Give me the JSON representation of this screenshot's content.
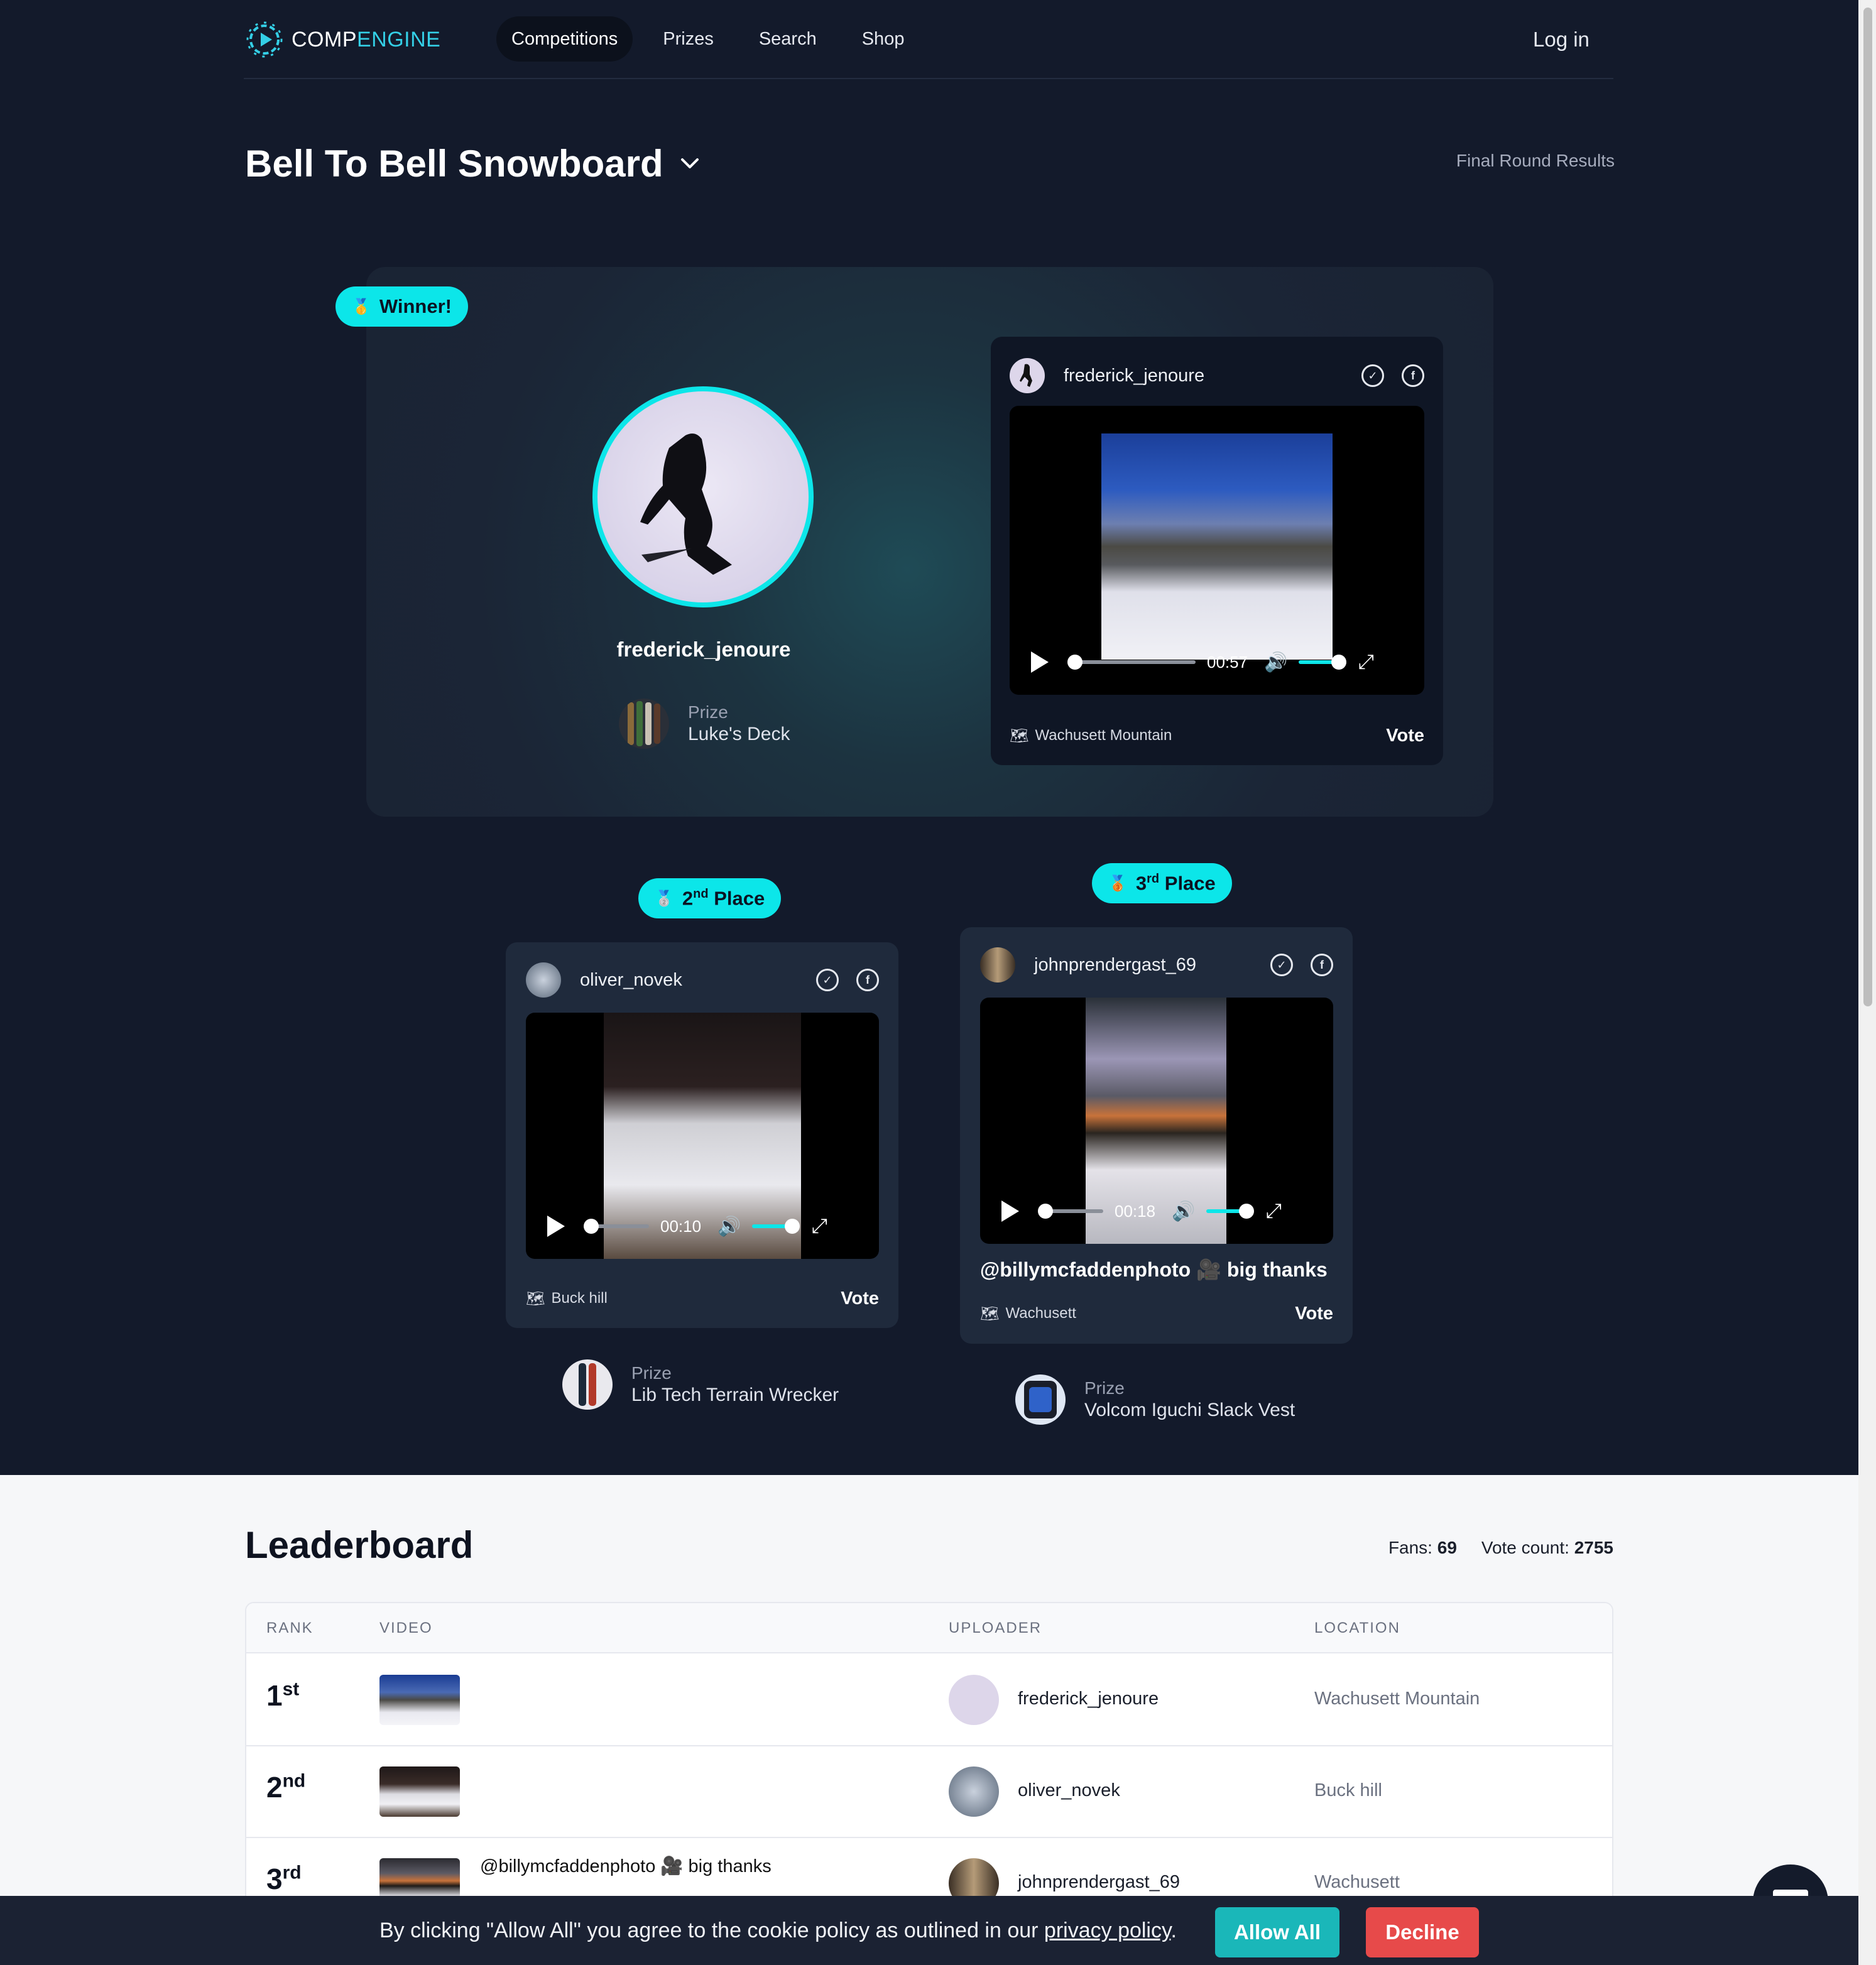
{
  "header": {
    "logo_part1": "COMP",
    "logo_part2": "ENGINE",
    "nav": [
      {
        "label": "Competitions",
        "active": true
      },
      {
        "label": "Prizes",
        "active": false
      },
      {
        "label": "Search",
        "active": false
      },
      {
        "label": "Shop",
        "active": false
      }
    ],
    "login": "Log in"
  },
  "competition": {
    "title": "Bell To Bell Snowboard",
    "subtitle": "Final Round Results"
  },
  "winner": {
    "badge": "Winner!",
    "username": "frederick_jenoure",
    "prize_label": "Prize",
    "prize_name": "Luke's Deck",
    "video": {
      "username": "frederick_jenoure",
      "time": "00:57",
      "location": "Wachusett Mountain",
      "vote_label": "Vote"
    }
  },
  "second": {
    "badge_num": "2",
    "badge_sup": "nd",
    "badge_word": "Place",
    "prize_label": "Prize",
    "prize_name": "Lib Tech Terrain Wrecker",
    "video": {
      "username": "oliver_novek",
      "time": "00:10",
      "location": "Buck hill",
      "vote_label": "Vote"
    }
  },
  "third": {
    "badge_num": "3",
    "badge_sup": "rd",
    "badge_word": "Place",
    "prize_label": "Prize",
    "prize_name": "Volcom Iguchi Slack Vest",
    "video": {
      "username": "johnprendergast_69",
      "time": "00:18",
      "caption": "@billymcfaddenphoto 🎥 big thanks",
      "location": "Wachusett",
      "vote_label": "Vote"
    }
  },
  "leaderboard": {
    "title": "Leaderboard",
    "fans_label": "Fans:",
    "fans": "69",
    "votes_label": "Vote count:",
    "votes": "2755",
    "columns": [
      "RANK",
      "VIDEO",
      "UPLOADER",
      "LOCATION"
    ],
    "rows": [
      {
        "rank": "1",
        "sup": "st",
        "caption": "",
        "uploader": "frederick_jenoure",
        "location": "Wachusett Mountain"
      },
      {
        "rank": "2",
        "sup": "nd",
        "caption": "",
        "uploader": "oliver_novek",
        "location": "Buck hill"
      },
      {
        "rank": "3",
        "sup": "rd",
        "caption": "@billymcfaddenphoto 🎥 big thanks",
        "uploader": "johnprendergast_69",
        "location": "Wachusett"
      }
    ]
  },
  "cookie": {
    "text_before": "By clicking \"Allow All\" you agree to the cookie policy as outlined in our ",
    "link": "privacy policy",
    "text_after": ".",
    "allow": "Allow All",
    "decline": "Decline"
  },
  "colors": {
    "background": "#131a2b",
    "accent": "#0ce6e9",
    "allow": "#1ab7b9",
    "decline": "#e74a4a"
  }
}
